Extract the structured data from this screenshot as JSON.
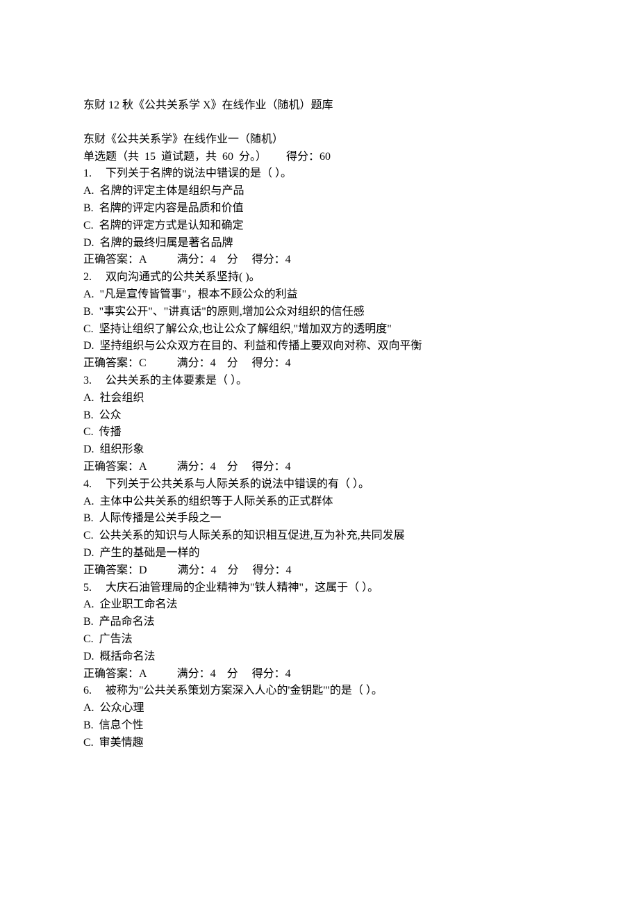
{
  "doc": {
    "title": "东财 12 秋《公共关系学 X》在线作业（随机）题库",
    "heading": "东财《公共关系学》在线作业一（随机）",
    "section_header": "单选题（共  15  道试题，共  60  分。）       得分：60",
    "questions": [
      {
        "num": "1.",
        "stem": "下列关于名牌的说法中错误的是（ ）。",
        "options": [
          "A.  名牌的评定主体是组织与产品",
          "B.  名牌的评定内容是品质和价值",
          "C.  名牌的评定方式是认知和确定",
          "D.  名牌的最终归属是著名品牌"
        ],
        "answer_line": "正确答案：A           满分：4    分     得分：4"
      },
      {
        "num": "2.",
        "stem": "双向沟通式的公共关系坚持( )。",
        "options": [
          "A.  \"凡是宣传皆管事\"，根本不顾公众的利益",
          "B.  \"事实公开\"、\"讲真话\"的原则,增加公众对组织的信任感",
          "C.  坚持让组织了解公众,也让公众了解组织,\"增加双方的透明度\"",
          "D.  坚持组织与公众双方在目的、利益和传播上要双向对称、双向平衡"
        ],
        "answer_line": "正确答案：C           满分：4    分     得分：4"
      },
      {
        "num": "3.",
        "stem": "公共关系的主体要素是（ ）。",
        "options": [
          "A.  社会组织",
          "B.  公众",
          "C.  传播",
          "D.  组织形象"
        ],
        "answer_line": "正确答案：A           满分：4    分     得分：4"
      },
      {
        "num": "4.",
        "stem": "下列关于公共关系与人际关系的说法中错误的有（ ）。",
        "options": [
          "A.  主体中公共关系的组织等于人际关系的正式群体",
          "B.  人际传播是公关手段之一",
          "C.  公共关系的知识与人际关系的知识相互促进,互为补充,共同发展",
          "D.  产生的基础是一样的"
        ],
        "answer_line": "正确答案：D           满分：4    分     得分：4"
      },
      {
        "num": "5.",
        "stem": "大庆石油管理局的企业精神为\"铁人精神\"，这属于（ ）。",
        "options": [
          "A.  企业职工命名法",
          "B.  产品命名法",
          "C.  广告法",
          "D.  概括命名法"
        ],
        "answer_line": "正确答案：A           满分：4    分     得分：4"
      },
      {
        "num": "6.",
        "stem": "被称为\"公共关系策划方案深入人心的'金钥匙'\"的是（ ）。",
        "options": [
          "A.  公众心理",
          "B.  信息个性",
          "C.  审美情趣"
        ],
        "answer_line": ""
      }
    ]
  }
}
